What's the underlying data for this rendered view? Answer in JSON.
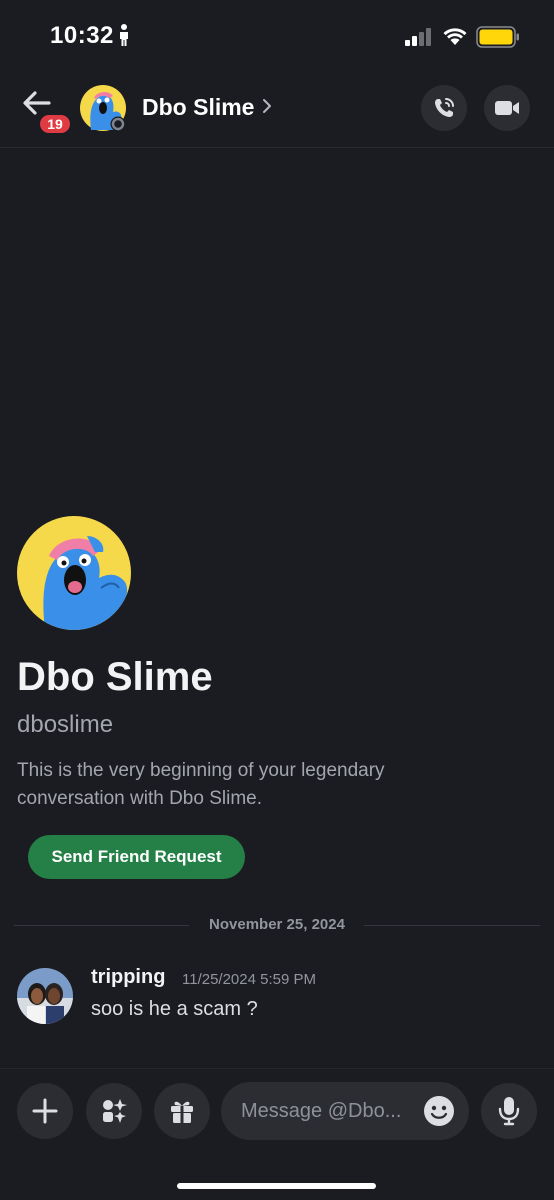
{
  "status_bar": {
    "time": "10:32",
    "battery_color": "#ffd60a"
  },
  "header": {
    "unread_count": "19",
    "contact_name": "Dbo Slime",
    "icons": [
      "back-arrow-icon",
      "chevron-right-icon",
      "phone-call-icon",
      "video-camera-icon"
    ]
  },
  "intro": {
    "display_name": "Dbo Slime",
    "username": "dboslime",
    "description": "This is the very beginning of your legendary conversation with Dbo Slime.",
    "friend_button_label": "Send Friend Request"
  },
  "divider": {
    "date": "November 25, 2024"
  },
  "messages": [
    {
      "author": "tripping",
      "timestamp": "11/25/2024 5:59 PM",
      "text": "soo is he a scam ?"
    }
  ],
  "composer": {
    "placeholder": "Message @Dbo...",
    "icons": [
      "plus-icon",
      "apps-icon",
      "gift-icon",
      "emoji-icon",
      "microphone-icon"
    ]
  },
  "colors": {
    "background": "#1b1c21",
    "button_bg": "#2b2d33",
    "accent_green": "#248046",
    "badge_red": "#e03b43",
    "avatar_yellow": "#f5d94a",
    "mascot_blue": "#3a8fe8"
  }
}
